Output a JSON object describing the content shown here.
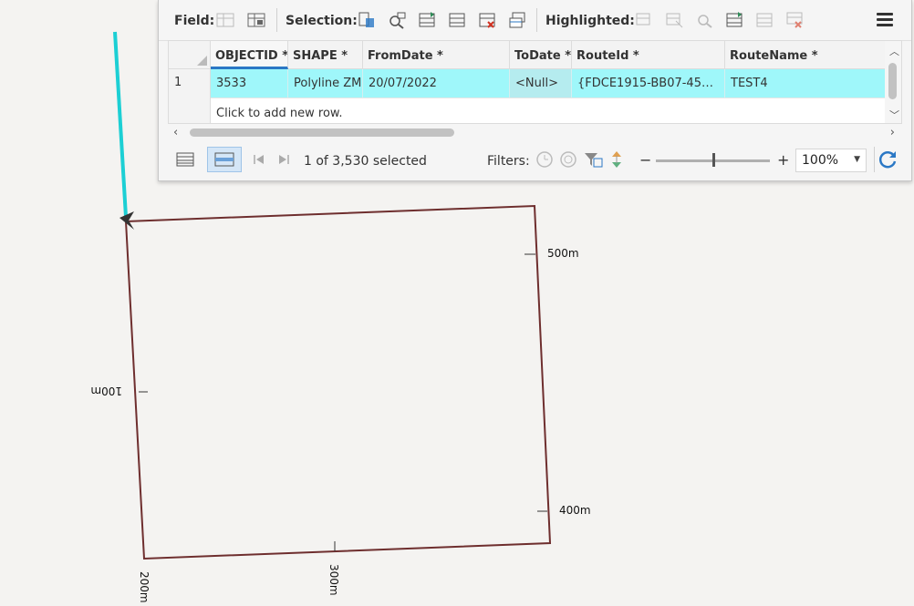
{
  "toolbar": {
    "field_label": "Field:",
    "selection_label": "Selection:",
    "highlighted_label": "Highlighted:"
  },
  "table": {
    "columns": [
      "OBJECTID *",
      "SHAPE *",
      "FromDate *",
      "ToDate *",
      "RouteId *",
      "RouteName *"
    ],
    "rows": [
      {
        "row_number": "1",
        "cells": [
          "3533",
          "Polyline ZM",
          "20/07/2022",
          "<Null>",
          "{FDCE1915-BB07-45C3...",
          "TEST4"
        ]
      }
    ],
    "add_row_text": "Click to add new row."
  },
  "status": {
    "selection_count": "1 of 3,530 selected",
    "filters_label": "Filters:",
    "zoom_minus": "−",
    "zoom_plus": "+",
    "zoom_value": "100%",
    "zoom_level": 0.5
  },
  "map": {
    "labels": [
      "500m",
      "100m",
      "400m",
      "300m",
      "200m"
    ],
    "route_color": "#6e2e2e",
    "highlight_color": "#1ccfd4"
  },
  "colors": {
    "selected_row": "#9ff7fa",
    "selected_header_underline": "#2b78c5"
  }
}
